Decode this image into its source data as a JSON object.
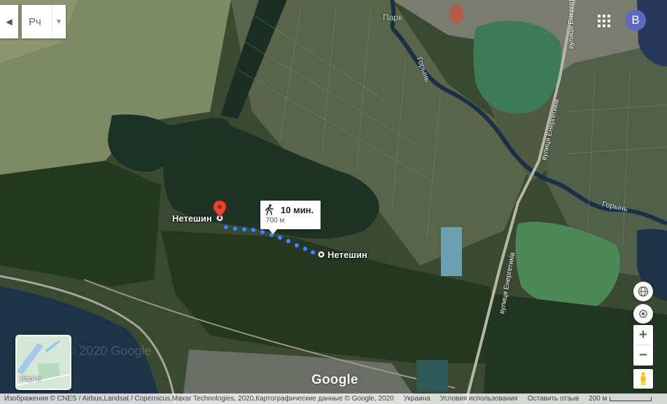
{
  "top_controls": {
    "collapse_icon": "chevron-left-icon",
    "language_label": "Рч",
    "dropdown_icon": "triangle-down-icon",
    "apps_icon": "grid-icon",
    "avatar_letter": "В"
  },
  "map_labels": {
    "park": "Парк",
    "river_top": "Горынь",
    "river_right": "Горынь",
    "street_top": "вулиця Енергетиків",
    "street_mid": "вулиця Енергетиків",
    "street_bottom": "вулиця Енергетиків",
    "origin": "Нетешин",
    "destination": "Нетешин"
  },
  "route": {
    "mode_icon": "walking-icon",
    "duration": "10 мин.",
    "distance": "700 м",
    "route_color": "#4285F4"
  },
  "layer_toggle": {
    "label": "Карта"
  },
  "right_controls": {
    "globe_icon": "globe-icon",
    "location_icon": "my-location-icon",
    "zoom_in": "+",
    "zoom_out": "−",
    "pegman_icon": "pegman-icon"
  },
  "branding": {
    "logo": "Google",
    "watermark": "© 2020 Google"
  },
  "footer": {
    "attribution": "Изображения © CNES / Airbus,Landsat / Copernicus,Maxar Technologies, 2020,Картографические данные © Google, 2020",
    "country": "Украина",
    "terms": "Условия использования",
    "feedback": "Оставить отзыв",
    "scale": "200 м"
  }
}
